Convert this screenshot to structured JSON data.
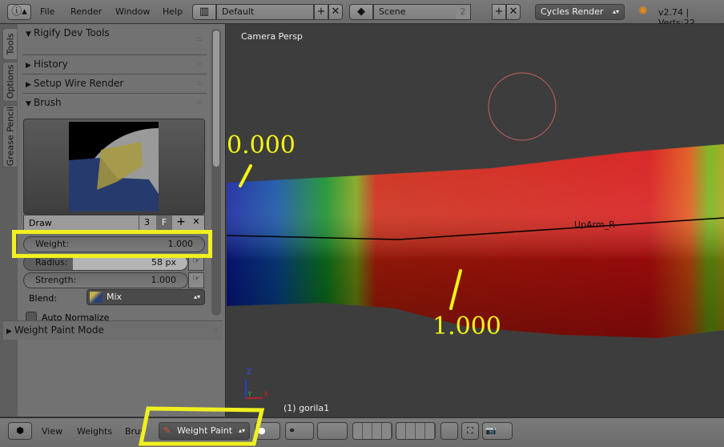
{
  "topbar": {
    "info_icon": "info-icon",
    "menus": [
      "File",
      "Render",
      "Window",
      "Help"
    ],
    "screen_layout": "Default",
    "scene": "Scene",
    "scene_users": "2",
    "render_engine": "Cycles Render",
    "version_info": "v2.74 | Verts:22"
  },
  "left_panel": {
    "tabs": [
      "Tools",
      "Options",
      "Grease Pencil"
    ],
    "panels": [
      {
        "title": "Rigify Dev Tools",
        "expanded": true
      },
      {
        "title": "History",
        "expanded": false
      },
      {
        "title": "Setup Wire Render",
        "expanded": false
      },
      {
        "title": "Brush",
        "expanded": true
      }
    ],
    "brush": {
      "name": "Draw",
      "users": "3",
      "fake_user": "F",
      "weight_label": "Weight:",
      "weight_value": "1.000",
      "radius_label": "Radius:",
      "radius_value": "58 px",
      "strength_label": "Strength:",
      "strength_value": "1.000",
      "blend_label": "Blend:",
      "blend_value": "Mix",
      "auto_normalize_label": "Auto Normalize",
      "auto_normalize": false
    },
    "mode_panel": "Weight Paint Mode"
  },
  "viewport": {
    "view_label": "Camera Persp",
    "bone_name": "UpArm_R",
    "object_label": "(1) gorila1",
    "annotation_low": "0.000",
    "annotation_high": "1.000",
    "axes": [
      "Z",
      "Y",
      "X"
    ],
    "highlight_color": "#f5f516"
  },
  "bottombar": {
    "menus": [
      "View",
      "Weights",
      "Brush"
    ],
    "mode": "Weight Paint"
  }
}
